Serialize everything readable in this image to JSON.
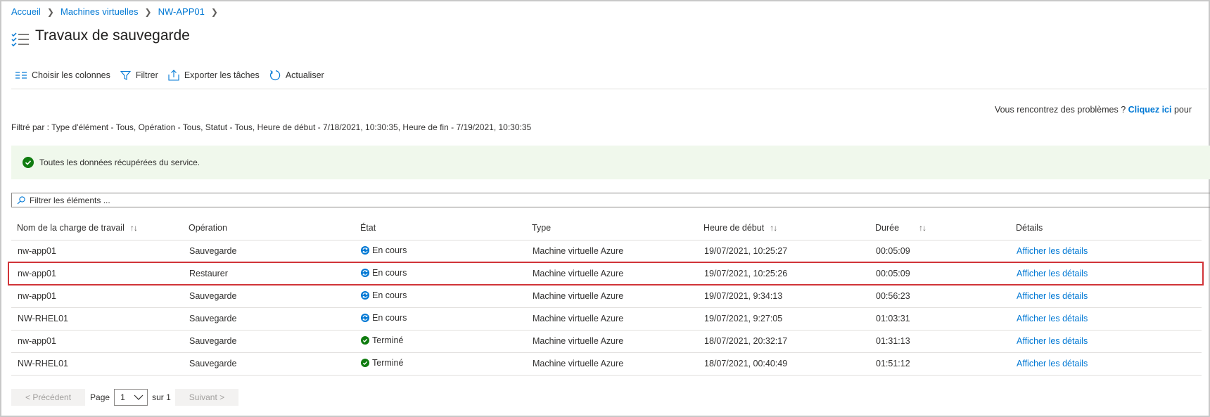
{
  "breadcrumb": [
    "Accueil",
    "Machines virtuelles",
    "NW-APP01"
  ],
  "page_title": "Travaux de sauvegarde",
  "toolbar": {
    "choose_columns": "Choisir les colonnes",
    "filter": "Filtrer",
    "export": "Exporter les tâches",
    "refresh": "Actualiser"
  },
  "help": {
    "prefix": "Vous rencontrez des problèmes ?",
    "link": "Cliquez ici",
    "suffix": "pour"
  },
  "filter_summary": "Filtré par : Type d'élément - Tous, Opération - Tous, Statut - Tous, Heure de début - 7/18/2021, 10:30:35, Heure de fin - 7/19/2021, 10:30:35",
  "info_message": "Toutes les données récupérées du service.",
  "search": {
    "placeholder": "Filtrer les éléments ..."
  },
  "table": {
    "headers": [
      "Nom de la charge de travail",
      "Opération",
      "État",
      "Type",
      "Heure de début",
      "Durée",
      "Détails"
    ],
    "rows": [
      {
        "workload": "nw-app01",
        "operation": "Sauvegarde",
        "status": "En cours",
        "status_kind": "in-progress",
        "type": "Machine virtuelle Azure",
        "start": "19/07/2021, 10:25:27",
        "duration": "00:05:09",
        "details": "Afficher les détails"
      },
      {
        "workload": "nw-app01",
        "operation": "Restaurer",
        "status": "En cours",
        "status_kind": "in-progress",
        "type": "Machine virtuelle Azure",
        "start": "19/07/2021, 10:25:26",
        "duration": "00:05:09",
        "details": "Afficher les détails"
      },
      {
        "workload": "nw-app01",
        "operation": "Sauvegarde",
        "status": "En cours",
        "status_kind": "in-progress",
        "type": "Machine virtuelle Azure",
        "start": "19/07/2021, 9:34:13",
        "duration": "00:56:23",
        "details": "Afficher les détails"
      },
      {
        "workload": "NW-RHEL01",
        "operation": "Sauvegarde",
        "status": "En cours",
        "status_kind": "in-progress",
        "type": "Machine virtuelle Azure",
        "start": "19/07/2021, 9:27:05",
        "duration": "01:03:31",
        "details": "Afficher les détails"
      },
      {
        "workload": "nw-app01",
        "operation": "Sauvegarde",
        "status": "Terminé",
        "status_kind": "completed",
        "type": "Machine virtuelle Azure",
        "start": "18/07/2021, 20:32:17",
        "duration": "01:31:13",
        "details": "Afficher les détails"
      },
      {
        "workload": "NW-RHEL01",
        "operation": "Sauvegarde",
        "status": "Terminé",
        "status_kind": "completed",
        "type": "Machine virtuelle Azure",
        "start": "18/07/2021, 00:40:49",
        "duration": "01:51:12",
        "details": "Afficher les détails"
      }
    ]
  },
  "pager": {
    "prev": "< Précédent",
    "page_label": "Page",
    "page_value": "1",
    "of_label": "sur 1",
    "next": "Suivant >"
  },
  "colors": {
    "link": "#0078d4",
    "success": "#107c10",
    "in_progress": "#0078d4",
    "highlight": "#d13438",
    "info_bg": "#f0f8ec"
  },
  "icons": [
    "checklist-icon",
    "columns-icon",
    "funnel-icon",
    "export-icon",
    "refresh-icon",
    "checkmark-circle-icon",
    "search-icon",
    "sync-icon",
    "chevron-down-icon"
  ]
}
